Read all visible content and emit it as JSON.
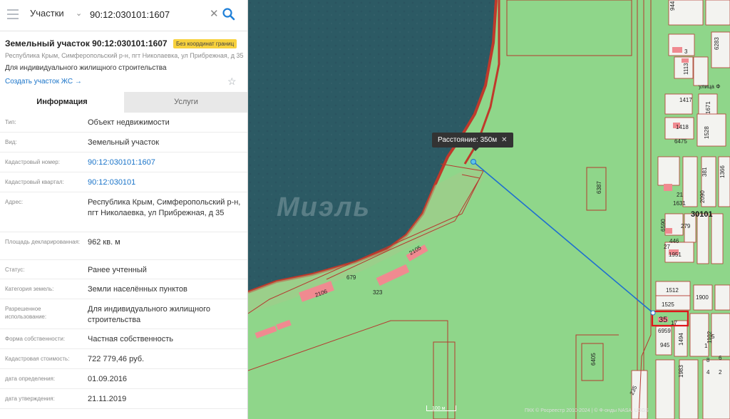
{
  "search": {
    "type_label": "Участки",
    "query": "90:12:030101:1607",
    "clear_icon": "close-icon",
    "search_icon": "magnifier-icon"
  },
  "card": {
    "title": "Земельный участок 90:12:030101:1607",
    "badge": "Без координат границ",
    "address_short": "Республика Крым, Симферопольский р-н, пгт Николаевка, ул Прибрежная, д 35",
    "purpose": "Для индивидуального жилищного строительства",
    "create_link": "Создать участок ЖС",
    "favorite_icon": "star-icon"
  },
  "tabs": [
    {
      "label": "Информация",
      "active": true
    },
    {
      "label": "Услуги",
      "active": false
    }
  ],
  "rows": [
    {
      "label": "Тип:",
      "value": "Объект недвижимости"
    },
    {
      "label": "Вид:",
      "value": "Земельный участок"
    },
    {
      "label": "Кадастровый номер:",
      "value": "90:12:030101:1607"
    },
    {
      "label": "Кадастровый квартал:",
      "value": "90:12:030101"
    },
    {
      "label": "Адрес:",
      "value": "Республика Крым, Симферопольский р-н, пгт Николаевка, ул Прибрежная, д 35"
    },
    {
      "label": "Площадь декларированная:",
      "value": "962 кв. м"
    },
    {
      "label": "Статус:",
      "value": "Ранее учтенный"
    },
    {
      "label": "Категория земель:",
      "value": "Земли населённых пунктов"
    },
    {
      "label": "Разрешенное использование:",
      "value": "Для индивидуального жилищного строительства"
    },
    {
      "label": "Форма собственности:",
      "value": "Частная собственность"
    },
    {
      "label": "Кадастровая стоимость:",
      "value": "722 779,46 руб."
    },
    {
      "label": "дата определения:",
      "value": "01.09.2016"
    },
    {
      "label": "дата утверждения:",
      "value": "21.11.2019"
    }
  ],
  "map": {
    "distance_label": "Расстояние: 350м",
    "scale_label": "100 м",
    "attribution": "ПКК © Росреестр 2010-2024 | © Ф-онды NASA, USGS",
    "watermark": "Миэль",
    "quarter_label": "30101",
    "parcel_labels": [
      "35",
      "2106",
      "2105",
      "679",
      "323",
      "6387",
      "6405",
      "1512",
      "1525",
      "1900",
      "6959",
      "945",
      "1494",
      "1102",
      "1418",
      "6475",
      "1528",
      "1417",
      "1671",
      "1631",
      "2090",
      "381",
      "1366",
      "279",
      "1951",
      "446",
      "6590",
      "1983",
      "235",
      "1113",
      "6283",
      "944",
      "21",
      "27",
      "17",
      "3",
      "5",
      "1",
      "8",
      "6",
      "4",
      "2"
    ],
    "street_label": "улица Ф",
    "colors": {
      "water": "#2c5a64",
      "land_overlay": "#8fd68a",
      "boundary": "#c0392b",
      "measure_line": "#1f6fd0",
      "building": "#f08a90"
    }
  }
}
